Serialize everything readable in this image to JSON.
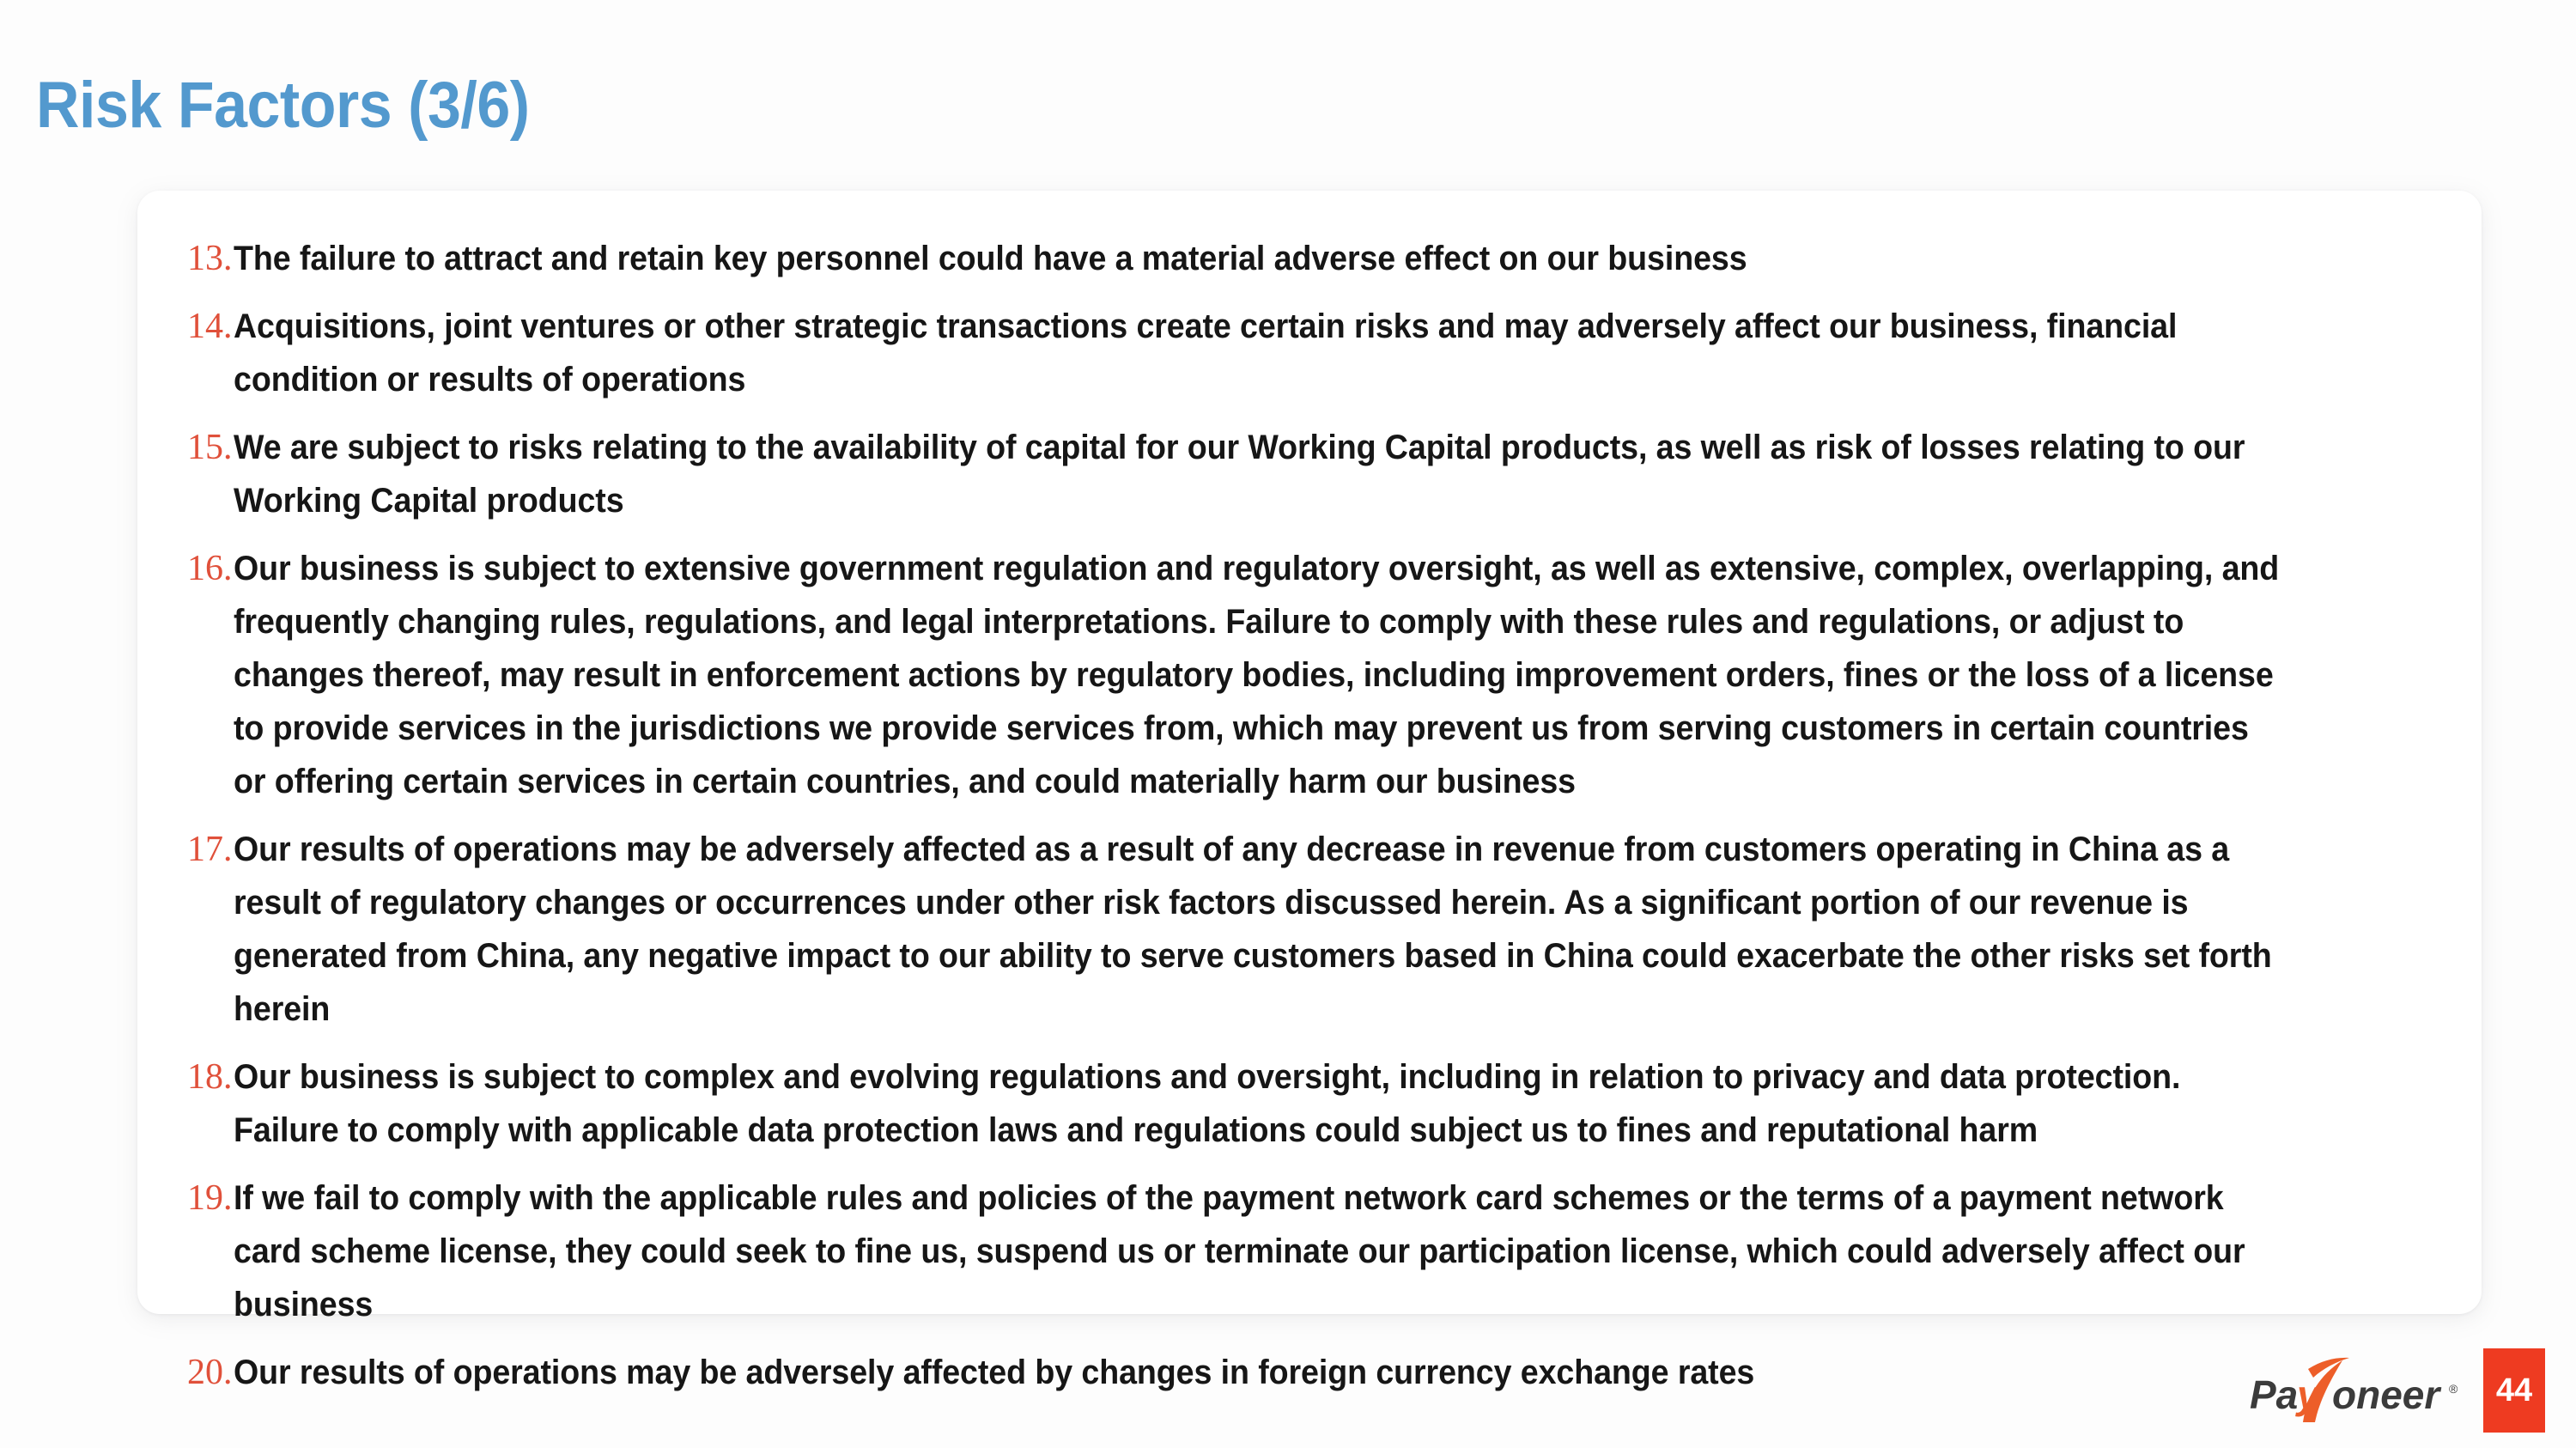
{
  "slide": {
    "title": "Risk Factors (3/6)",
    "title_color": "#5399CE",
    "background_color": "#FDFDFD",
    "card_background": "#FFFFFF"
  },
  "risk_factors": {
    "number_color": "#E0503A",
    "text_color": "#161616",
    "items": [
      {
        "number": "13.",
        "text": "The failure to attract and retain key personnel could have a material adverse effect on our business"
      },
      {
        "number": "14.",
        "text": "Acquisitions, joint ventures or other strategic transactions create certain risks and may adversely affect our business, financial condition or results of operations"
      },
      {
        "number": "15.",
        "text": "We are subject to risks relating to the availability of capital for our Working Capital products, as well as risk of losses relating to our Working Capital products"
      },
      {
        "number": "16.",
        "text": "Our business is subject to extensive government regulation and regulatory oversight, as well as extensive, complex, overlapping, and frequently changing rules, regulations, and legal interpretations. Failure to comply with these rules and regulations, or adjust to changes thereof, may result in enforcement actions by regulatory bodies, including improvement orders, fines or the loss of a license to provide services in the jurisdictions we provide services from, which may prevent us from serving customers in certain countries or offering certain services in certain countries, and could materially harm our business"
      },
      {
        "number": "17.",
        "text": "Our results of operations may be adversely affected as a result of any decrease in revenue from customers operating in China as a result of regulatory changes or occurrences under other risk factors discussed herein. As a significant portion of our revenue is generated from China, any negative impact to our ability to serve customers based in China could exacerbate the other risks set forth herein"
      },
      {
        "number": "18.",
        "text": "Our business is subject to complex and evolving regulations and oversight, including in relation to privacy and data protection. Failure to comply with applicable data protection laws and regulations could subject us to fines and reputational harm"
      },
      {
        "number": "19.",
        "text": "If we fail to comply with the applicable rules and policies of the payment network card schemes or the terms of a payment network card scheme license, they could seek to fine us, suspend us or terminate our participation license, which could adversely affect our business"
      },
      {
        "number": "20.",
        "text": "Our results of operations may be adversely affected by changes in foreign currency exchange rates"
      }
    ]
  },
  "footer": {
    "logo_text_part1": "Pa",
    "logo_text_accent": "y",
    "logo_text_part2": "oneer",
    "logo_trademark": "®",
    "logo_dark_color": "#3B3B3B",
    "logo_accent_color": "#ED5E29",
    "page_number": "44",
    "page_badge_color": "#EE3B21"
  }
}
